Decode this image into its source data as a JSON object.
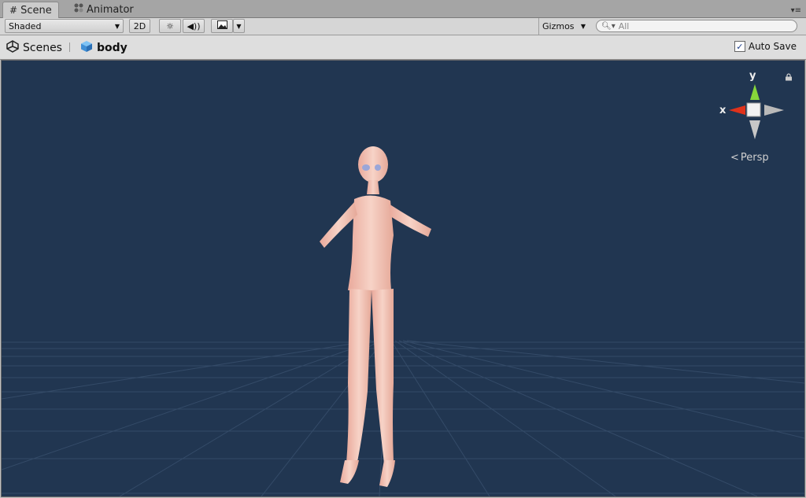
{
  "tabs": [
    {
      "label": "Scene",
      "icon": "grid-icon",
      "active": true
    },
    {
      "label": "Animator",
      "icon": "animator-icon",
      "active": false
    }
  ],
  "toolbar": {
    "shading_mode": "Shaded",
    "mode_2d": "2D",
    "gizmos_label": "Gizmos",
    "search_placeholder": "All"
  },
  "breadcrumb": {
    "scenes_label": "Scenes",
    "prefab_label": "body"
  },
  "autosave": {
    "label": "Auto Save",
    "checked": true
  },
  "viewport": {
    "background": "#213651",
    "gizmo": {
      "x_label": "x",
      "y_label": "y",
      "projection": "Persp",
      "x_color": "#e0321b",
      "y_color": "#86d63a"
    }
  }
}
